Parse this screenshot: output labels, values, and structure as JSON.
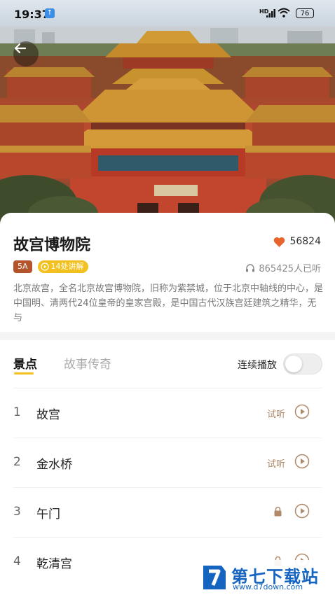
{
  "status_bar": {
    "time": "19:37",
    "network": "HD",
    "battery": "76"
  },
  "attraction": {
    "title": "故宫博物院",
    "likes": "56824",
    "rating_badge": "5A",
    "spots_badge": "14处讲解",
    "listeners": "865425人已听",
    "description": "北京故宫，全名北京故宫博物院，旧称为紫禁城，位于北京中轴线的中心，是中国明、清两代24位皇帝的皇家宫殿，是中国古代汉族宫廷建筑之精华，无与"
  },
  "tabs": {
    "items": [
      "景点",
      "故事传奇"
    ],
    "active": 0,
    "autoplay_label": "连续播放",
    "autoplay_on": false
  },
  "spots": [
    {
      "num": "1",
      "name": "故宫",
      "trial": "试听",
      "locked": false
    },
    {
      "num": "2",
      "name": "金水桥",
      "trial": "试听",
      "locked": false
    },
    {
      "num": "3",
      "name": "午门",
      "trial": "",
      "locked": true
    },
    {
      "num": "4",
      "name": "乾清宫",
      "trial": "",
      "locked": true
    }
  ],
  "watermark": {
    "title": "第七下载站",
    "url": "www.d7down.com"
  },
  "colors": {
    "accent_yellow": "#f3c11f",
    "badge_brown": "#b3542b",
    "heart": "#e8642c",
    "trial_text": "#b08968",
    "watermark_blue": "#1565c0"
  },
  "icons": {
    "back": "arrow-left-icon",
    "heart": "heart-icon",
    "headphones": "headphones-icon",
    "play": "play-circle-icon",
    "lock": "lock-icon"
  }
}
